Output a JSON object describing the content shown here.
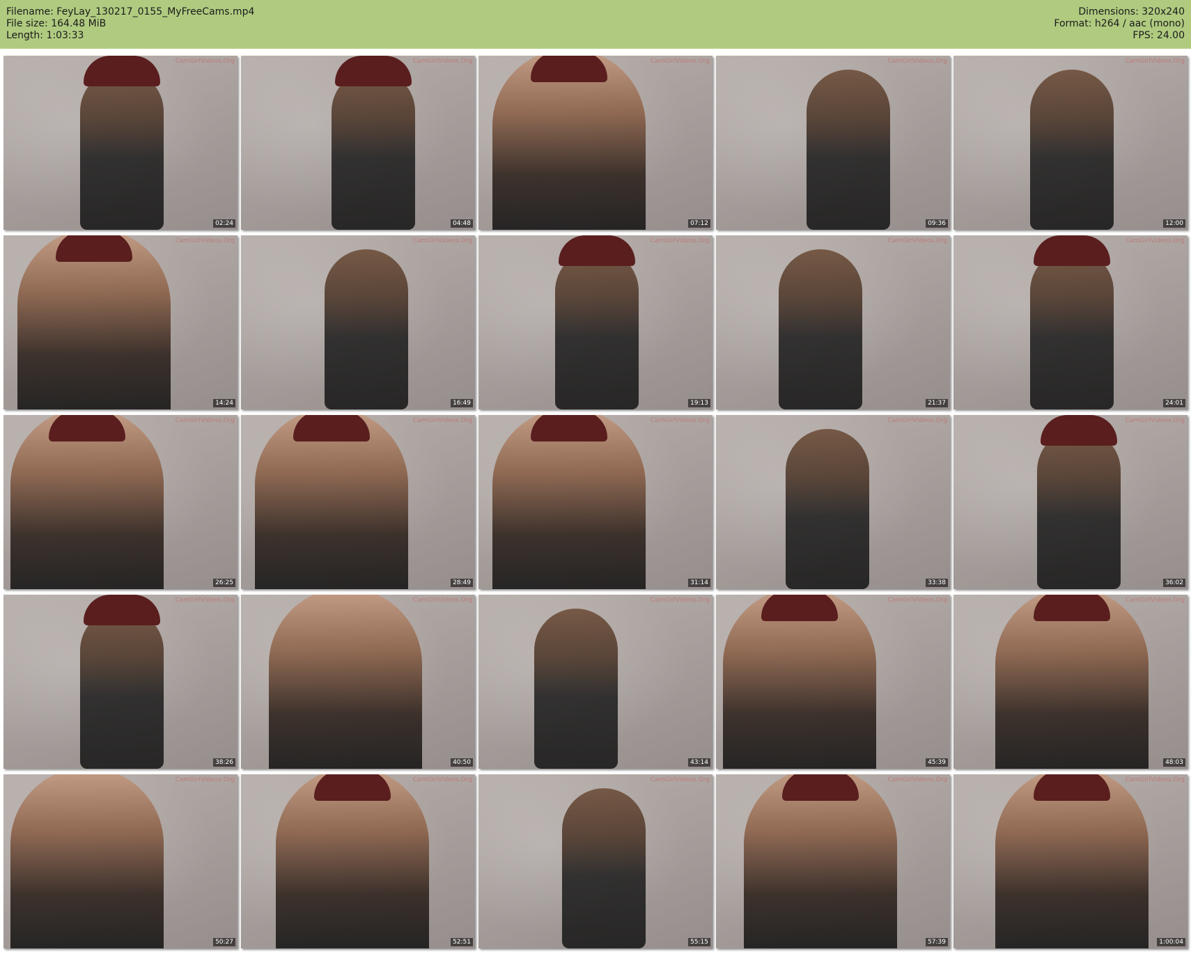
{
  "meta": {
    "filename": "Filename: FeyLay_130217_0155_MyFreeCams.mp4",
    "filesize": "File size: 164.48 MiB",
    "length": "Length: 1:03:33",
    "dimensions": "Dimensions: 320x240",
    "format": "Format: h264 / aac (mono)",
    "fps": "FPS: 24.00"
  },
  "watermark": "CamGirlVideos.Org",
  "thumbnails": [
    {
      "time": "02:24"
    },
    {
      "time": "04:48"
    },
    {
      "time": "07:12"
    },
    {
      "time": "09:36"
    },
    {
      "time": "12:00"
    },
    {
      "time": "14:24"
    },
    {
      "time": "16:49"
    },
    {
      "time": "19:13"
    },
    {
      "time": "21:37"
    },
    {
      "time": "24:01"
    },
    {
      "time": "26:25"
    },
    {
      "time": "28:49"
    },
    {
      "time": "31:14"
    },
    {
      "time": "33:38"
    },
    {
      "time": "36:02"
    },
    {
      "time": "38:26"
    },
    {
      "time": "40:50"
    },
    {
      "time": "43:14"
    },
    {
      "time": "45:39"
    },
    {
      "time": "48:03"
    },
    {
      "time": "50:27"
    },
    {
      "time": "52:51"
    },
    {
      "time": "55:15"
    },
    {
      "time": "57:39"
    },
    {
      "time": "1:00:04"
    }
  ]
}
